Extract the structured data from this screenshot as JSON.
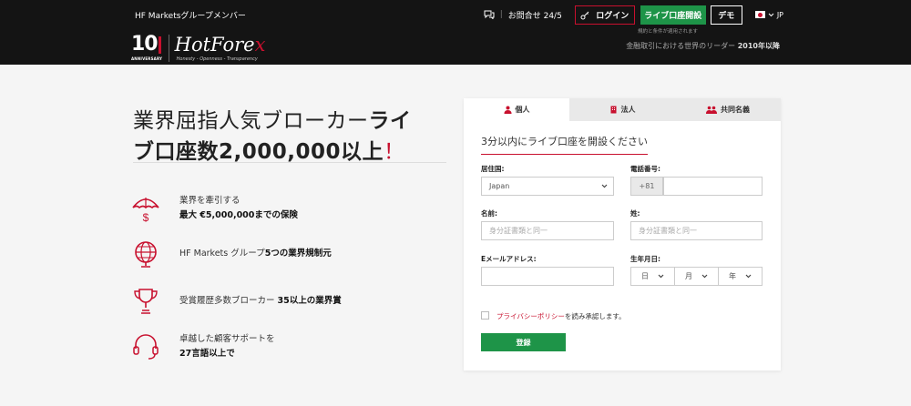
{
  "header": {
    "group_member": "HF Marketsグループメンバー",
    "contact": "お問合せ 24/5",
    "login": "ログイン",
    "open_live": "ライブ口座開設",
    "demo": "デモ",
    "lang": "JP",
    "terms_note": "規約と条件が適用されます",
    "tagline_prefix": "金融取引における世界のリーダー",
    "tagline_years": "2010年以降"
  },
  "logo": {
    "ten": "10",
    "anniversary": "ANNIVERSARY",
    "brand_main": "HotFore",
    "brand_x": "x",
    "slogan": "Honesty - Openness - Transparency"
  },
  "hero": {
    "line1_normal": "業界屈指人気ブローカー",
    "line1_bold": "ライ",
    "line2_bold": "ブ口座数2,000,000以上",
    "line2_mark": "！"
  },
  "features": [
    {
      "icon": "umbrella-dollar-icon",
      "l1": "業界を牽引する",
      "l2": "最大 €5,000,000までの保険"
    },
    {
      "icon": "globe-icon",
      "l1a": "HF Markets グループ",
      "l1b": "5つの業界規制元"
    },
    {
      "icon": "trophy-icon",
      "l1a": "受賞履歴多数ブローカー ",
      "l1b": "35以上の業界賞"
    },
    {
      "icon": "headset-icon",
      "l1": "卓越した顧客サポートを",
      "l2": "27言語以上で"
    }
  ],
  "form": {
    "tabs": [
      "個人",
      "法人",
      "共同名義"
    ],
    "title": "3分以内にライブ口座を開設ください",
    "residence_label": "居住国:",
    "residence_value": "Japan",
    "phone_label": "電話番号:",
    "phone_prefix": "+81",
    "first_name_label": "名前:",
    "first_name_placeholder": "身分証書類と同一",
    "last_name_label": "姓:",
    "last_name_placeholder": "身分証書類と同一",
    "email_label": "Eメールアドレス:",
    "dob_label": "生年月日:",
    "dob_day": "日",
    "dob_month": "月",
    "dob_year": "年",
    "privacy_link": "プライバシーポリシー",
    "privacy_text": "を読み承認します。",
    "submit": "登録"
  },
  "colors": {
    "accent_red": "#c8102e",
    "green": "#1e9448",
    "header_bg": "#141414"
  }
}
